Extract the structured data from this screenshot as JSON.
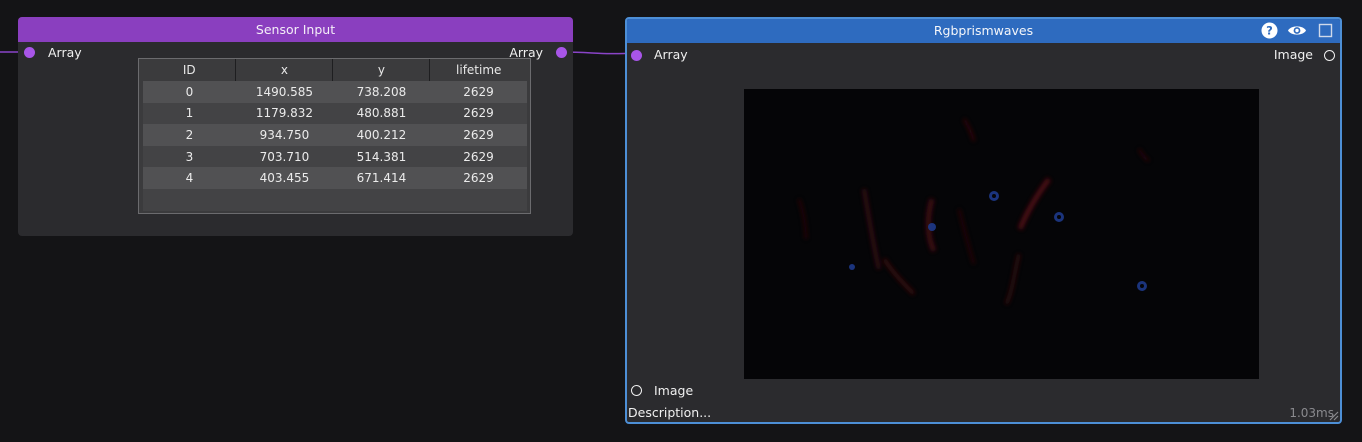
{
  "sensor_node": {
    "title": "Sensor Input",
    "input_label": "Array",
    "output_label": "Array",
    "table": {
      "columns": [
        "ID",
        "x",
        "y",
        "lifetime"
      ],
      "rows": [
        [
          "0",
          "1490.585",
          "738.208",
          "2629"
        ],
        [
          "1",
          "1179.832",
          "480.881",
          "2629"
        ],
        [
          "2",
          "934.750",
          "400.212",
          "2629"
        ],
        [
          "3",
          "703.710",
          "514.381",
          "2629"
        ],
        [
          "4",
          "403.455",
          "671.414",
          "2629"
        ]
      ]
    },
    "colors": {
      "header": "#8a3fbf",
      "port": "#a855e8"
    }
  },
  "rgb_node": {
    "title": "Rgbprismwaves",
    "input_label": "Array",
    "output_label": "Image",
    "image_input_label": "Image",
    "description": "Description...",
    "timing": "1.03ms",
    "header_icons": [
      "help-icon",
      "eye-icon",
      "square-icon"
    ],
    "colors": {
      "header": "#2e6bbf",
      "border": "#4d8fd6"
    }
  }
}
